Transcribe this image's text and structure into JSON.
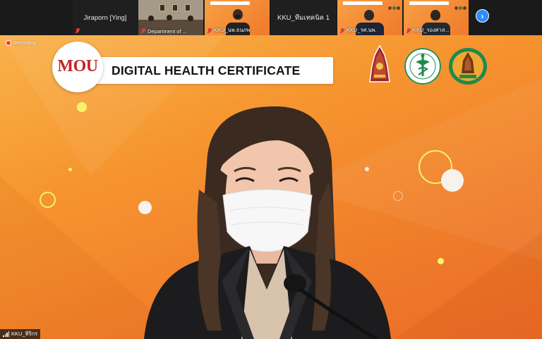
{
  "thumbnails": [
    {
      "name": "Jiraporn [Ying]",
      "kind": "name-only",
      "muted": true
    },
    {
      "name": "Department of ...",
      "kind": "room",
      "muted": true
    },
    {
      "name": "KKU_นพ.ธนภพ",
      "kind": "orange",
      "muted": true
    },
    {
      "name": "KKU_ทีมเทคนิค 1",
      "kind": "name-only",
      "muted": false
    },
    {
      "name": "KKU_รศ.นพ.",
      "kind": "orange",
      "muted": true
    },
    {
      "name": "KKU_รองศาส...",
      "kind": "orange",
      "muted": true
    }
  ],
  "next_button_icon": "chevron-right-icon",
  "recording_label": "Recording",
  "banner": {
    "mou": "MOU",
    "title": "DIGITAL HEALTH CERTIFICATE"
  },
  "logos": [
    "khon-kaen-university-logo",
    "ministry-of-public-health-logo",
    "faculty-of-medicine-logo"
  ],
  "active_speaker_name": "KKU_ทิริกร",
  "colors": {
    "background_top": "#f9b24a",
    "background_bottom": "#ea6b26",
    "mou_red": "#c0272d",
    "moph_green": "#1e8a4c",
    "kku_maroon": "#9b2433",
    "zoom_blue": "#2d8cff",
    "mute_red": "#e23b3b"
  }
}
